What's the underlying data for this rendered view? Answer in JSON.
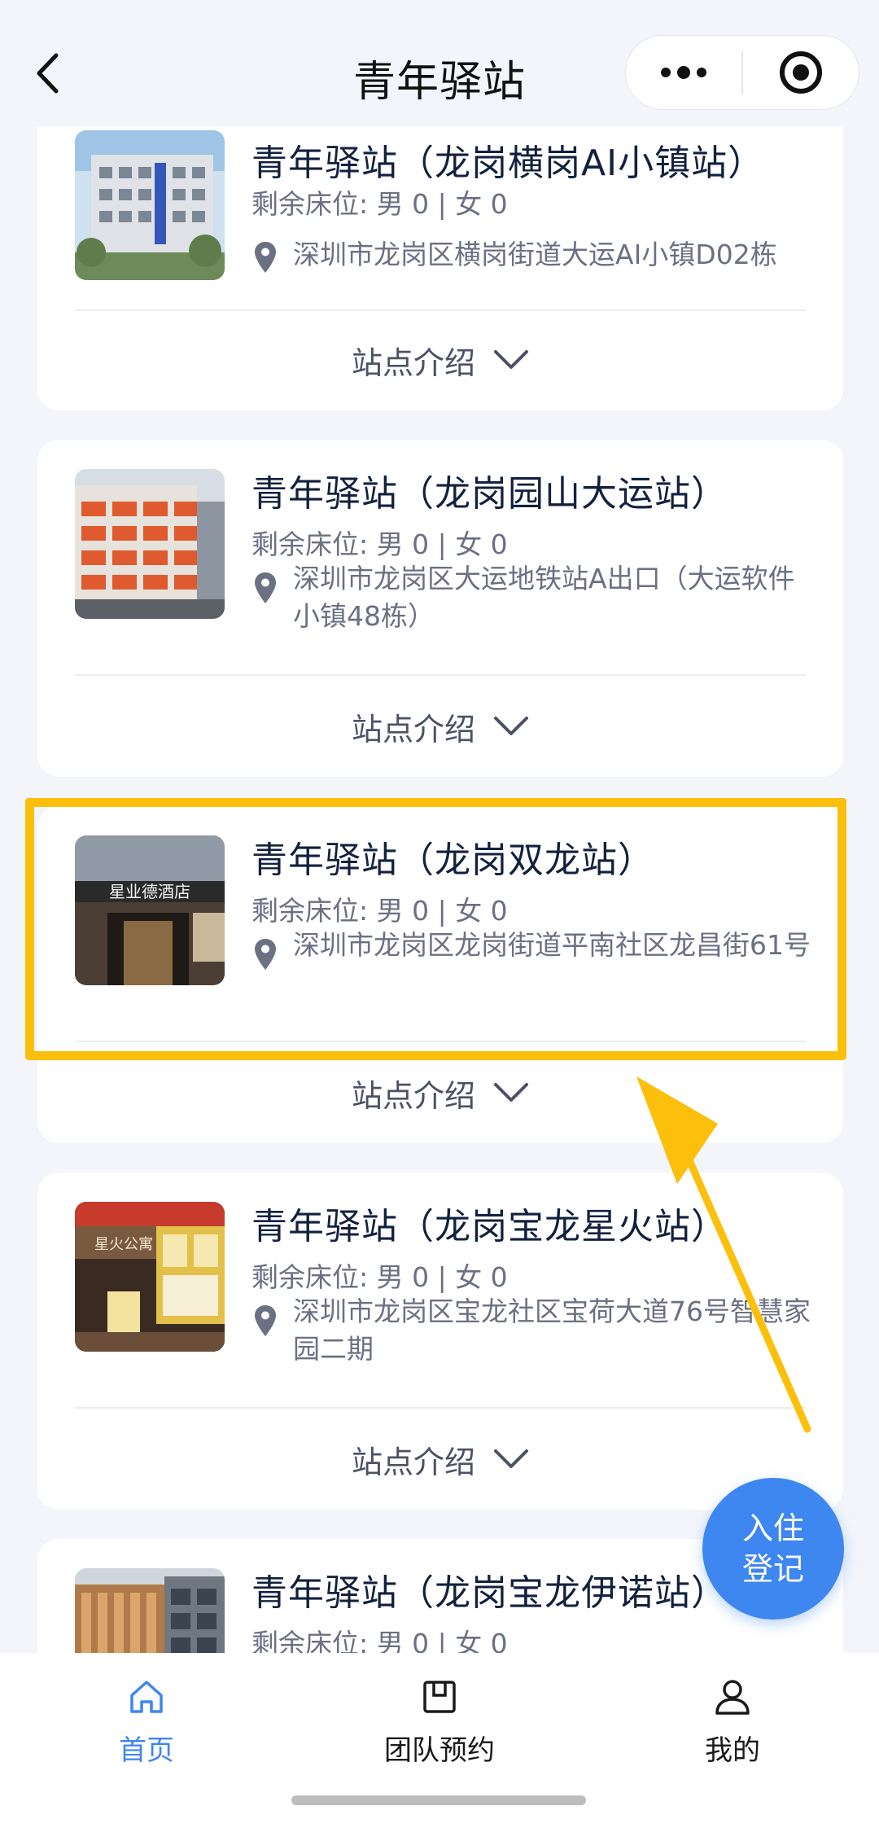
{
  "header": {
    "title": "青年驿站"
  },
  "stations": [
    {
      "name": "青年驿站（龙岗横岗AI小镇站）",
      "beds": "剩余床位: 男 0 | 女 0",
      "address": "深圳市龙岗区横岗街道大运AI小镇D02栋",
      "intro": "站点介绍"
    },
    {
      "name": "青年驿站（龙岗园山大运站）",
      "beds": "剩余床位: 男 0 | 女 0",
      "address": "深圳市龙岗区大运地铁站A出口（大运软件小镇48栋）",
      "intro": "站点介绍"
    },
    {
      "name": "青年驿站（龙岗双龙站）",
      "beds": "剩余床位: 男 0 | 女 0",
      "address": "深圳市龙岗区龙岗街道平南社区龙昌街61号",
      "intro": "站点介绍",
      "photo_sign": "星业德酒店"
    },
    {
      "name": "青年驿站（龙岗宝龙星火站）",
      "beds": "剩余床位: 男 0 | 女 0",
      "address": "深圳市龙岗区宝龙社区宝荷大道76号智慧家园二期",
      "intro": "站点介绍",
      "photo_sign": "星火公寓"
    },
    {
      "name": "青年驿站（龙岗宝龙伊诺站）",
      "beds": "剩余床位: 男 0 | 女 0"
    }
  ],
  "checkin_button": {
    "line1": "入住",
    "line2": "登记"
  },
  "tabbar": {
    "items": [
      {
        "label": "首页",
        "icon": "home-icon",
        "active": true
      },
      {
        "label": "团队预约",
        "icon": "calendar-icon",
        "active": false
      },
      {
        "label": "我的",
        "icon": "user-icon",
        "active": false
      }
    ]
  },
  "colors": {
    "accent": "#3e86f0",
    "highlight": "#fbbf0c",
    "background": "#f3f5fa"
  }
}
